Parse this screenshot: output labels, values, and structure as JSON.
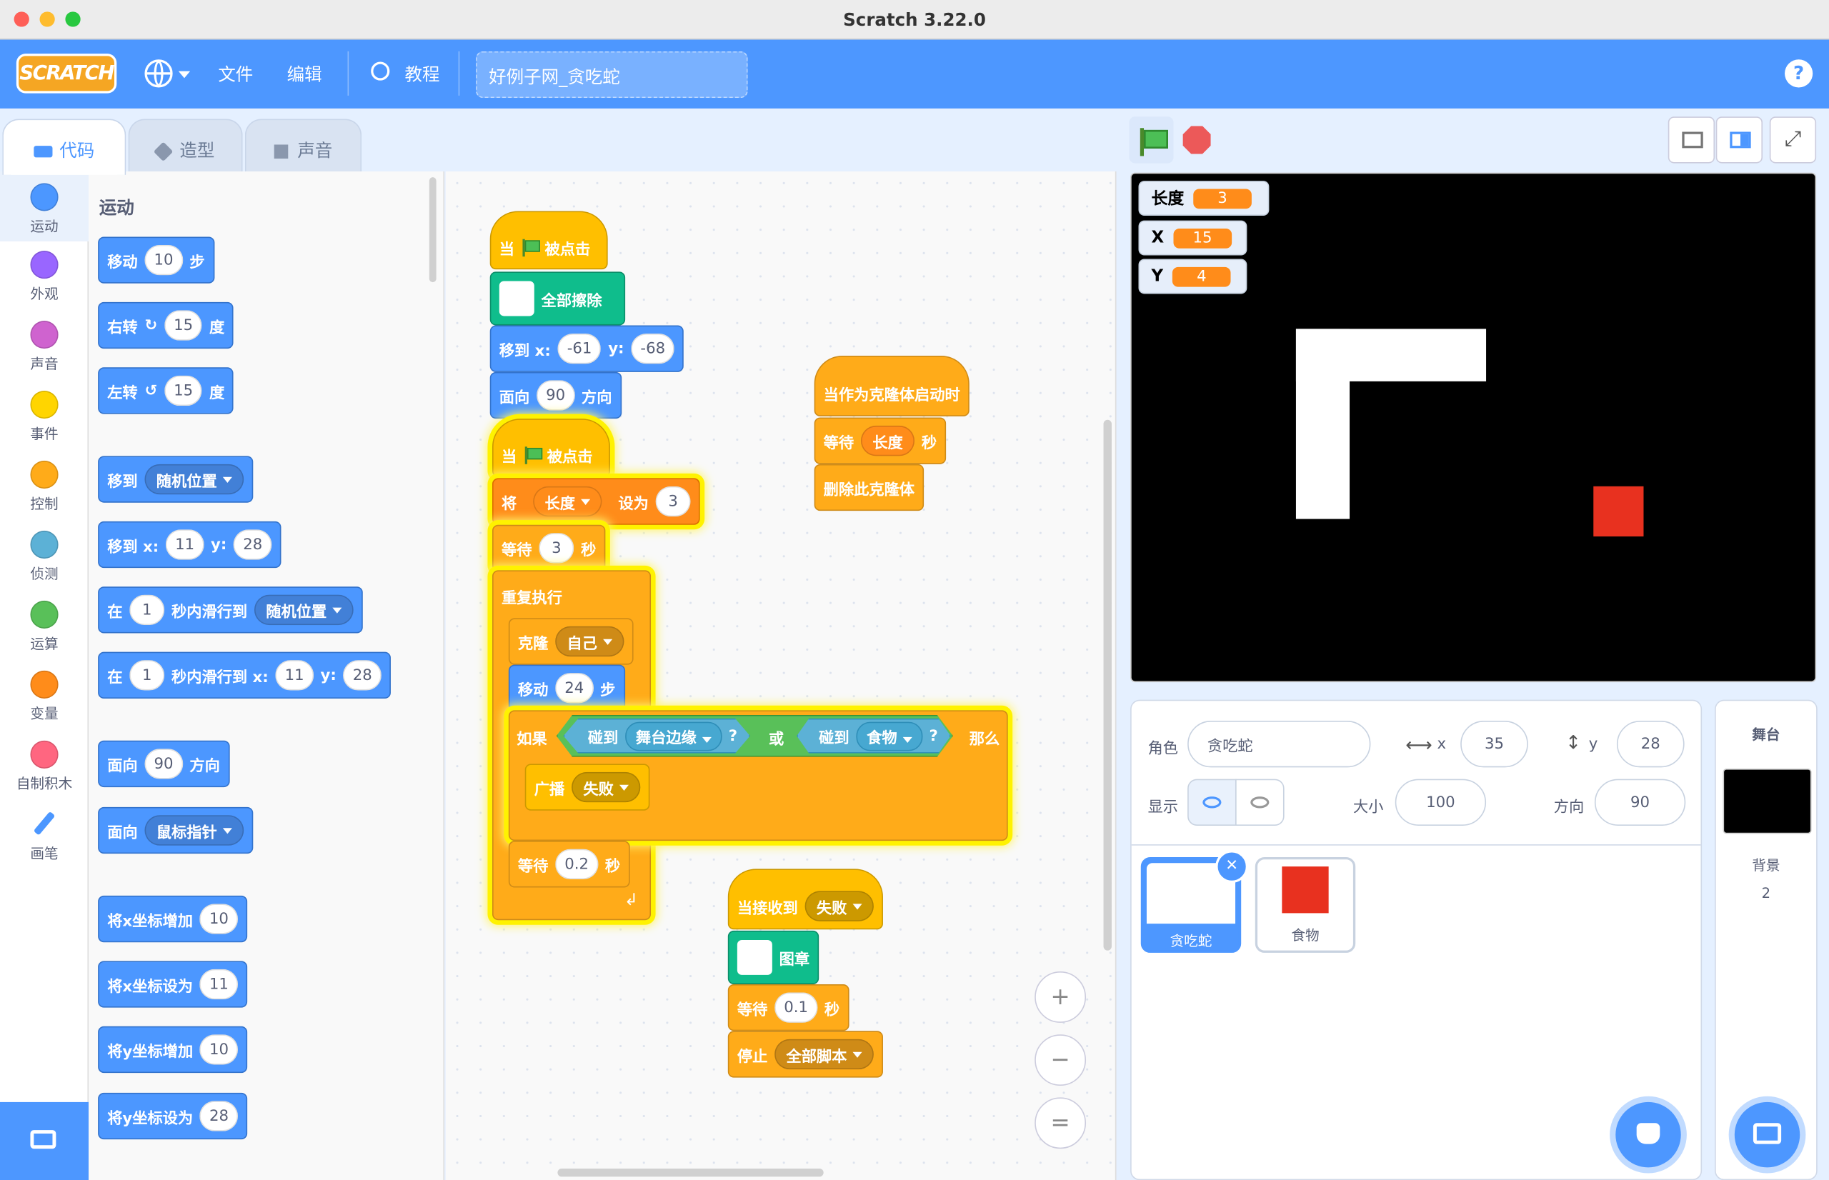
{
  "window": {
    "title": "Scratch 3.22.0"
  },
  "menu": {
    "logo": "SCRATCH",
    "file": "文件",
    "edit": "编辑",
    "tutorials": "教程",
    "project_name": "好例子网_贪吃蛇",
    "help": "?"
  },
  "tabs": {
    "code": "代码",
    "costumes": "造型",
    "sounds": "声音"
  },
  "categories": [
    {
      "label": "运动",
      "color": "#4c97ff"
    },
    {
      "label": "外观",
      "color": "#9966ff"
    },
    {
      "label": "声音",
      "color": "#cf63cf"
    },
    {
      "label": "事件",
      "color": "#ffd500"
    },
    {
      "label": "控制",
      "color": "#ffab19"
    },
    {
      "label": "侦测",
      "color": "#5cb1d6"
    },
    {
      "label": "运算",
      "color": "#59c059"
    },
    {
      "label": "变量",
      "color": "#ff8c1a"
    },
    {
      "label": "自制积木",
      "color": "#ff6680"
    },
    {
      "label": "画笔",
      "color": "#0fbd8c"
    }
  ],
  "palette": {
    "heading": "运动",
    "move": {
      "a": "移动",
      "v": "10",
      "b": "步"
    },
    "turn_right": {
      "a": "右转",
      "v": "15",
      "b": "度"
    },
    "turn_left": {
      "a": "左转",
      "v": "15",
      "b": "度"
    },
    "goto": {
      "a": "移到",
      "d": "随机位置"
    },
    "goto_xy": {
      "a": "移到 x:",
      "x": "11",
      "yl": "y:",
      "y": "28"
    },
    "glide": {
      "a": "在",
      "v": "1",
      "b": "秒内滑行到",
      "d": "随机位置"
    },
    "glide_xy": {
      "a": "在",
      "v": "1",
      "b": "秒内滑行到 x:",
      "x": "11",
      "yl": "y:",
      "y": "28"
    },
    "point_dir": {
      "a": "面向",
      "v": "90",
      "b": "方向"
    },
    "point_towards": {
      "a": "面向",
      "d": "鼠标指针"
    },
    "change_x": {
      "a": "将x坐标增加",
      "v": "10"
    },
    "set_x": {
      "a": "将x坐标设为",
      "v": "11"
    },
    "change_y": {
      "a": "将y坐标增加",
      "v": "10"
    },
    "set_y": {
      "a": "将y坐标设为",
      "v": "28"
    }
  },
  "script1": {
    "hat_a": "当",
    "hat_b": "被点击",
    "clear": "全部擦除",
    "goto_a": "移到 x:",
    "x": "-61",
    "yl": "y:",
    "y": "-68",
    "face_a": "面向",
    "face_v": "90",
    "face_b": "方向"
  },
  "script2": {
    "hat_a": "当",
    "hat_b": "被点击",
    "set_a": "将",
    "set_var": "长度",
    "set_b": "设为",
    "set_v": "3",
    "wait_a": "等待",
    "wait_v": "3",
    "wait_b": "秒",
    "forever": "重复执行",
    "clone_a": "克隆",
    "clone_d": "自己",
    "move_a": "移动",
    "move_v": "24",
    "move_b": "步",
    "if_a": "如果",
    "touch1": "碰到",
    "touch1_d": "舞台边缘",
    "q": "?",
    "or": "或",
    "touch2": "碰到",
    "touch2_d": "食物",
    "then": "那么",
    "bcast": "广播",
    "bcast_d": "失败",
    "wait2_a": "等待",
    "wait2_v": "0.2",
    "wait2_b": "秒"
  },
  "script3": {
    "hat": "当作为克隆体启动时",
    "wait_a": "等待",
    "wait_var": "长度",
    "wait_b": "秒",
    "delete": "删除此克隆体"
  },
  "script4": {
    "hat": "当接收到",
    "hat_d": "失败",
    "stamp": "图章",
    "wait_a": "等待",
    "wait_v": "0.1",
    "wait_b": "秒",
    "stop": "停止",
    "stop_d": "全部脚本"
  },
  "zoom": {
    "in": "+",
    "out": "−",
    "reset": "="
  },
  "monitors": [
    {
      "name": "长度",
      "value": "3"
    },
    {
      "name": "X",
      "value": "15"
    },
    {
      "name": "Y",
      "value": "4"
    }
  ],
  "sprite_info": {
    "sprite_label": "角色",
    "sprite_name": "贪吃蛇",
    "x_label": "x",
    "x": "35",
    "y_label": "y",
    "y": "28",
    "show_label": "显示",
    "size_label": "大小",
    "size": "100",
    "dir_label": "方向",
    "dir": "90"
  },
  "sprites": [
    {
      "name": "贪吃蛇"
    },
    {
      "name": "食物"
    }
  ],
  "stage_panel": {
    "title": "舞台",
    "bg_label": "背景",
    "bg_count": "2"
  }
}
